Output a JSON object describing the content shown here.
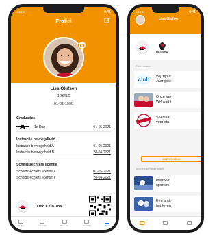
{
  "brand_color": "#f39200",
  "phone1": {
    "status_time": "9:41",
    "title": "Profiel",
    "profile": {
      "name": "Lisa Olufsen",
      "member_number": "123456",
      "birthdate": "01-01-1990"
    },
    "graduaties": {
      "title": "Graduaties",
      "rows": [
        {
          "label": "1e Dan",
          "date": "01-05-2021"
        }
      ]
    },
    "instructie": {
      "title": "Instructie bevoegdheid",
      "rows": [
        {
          "label": "Instructie bevoegdheid A",
          "date": "01-05-2021"
        },
        {
          "label": "Instructie bevoegdheid B",
          "date": "28-04-2021"
        }
      ]
    },
    "scheidsrechters": {
      "title": "Scheidsrechters licentie",
      "rows": [
        {
          "label": "Scheidsrechters licentie X",
          "date": "01-05-2021"
        },
        {
          "label": "Scheidsrechters licentie Y",
          "date": "28-04-2021"
        }
      ]
    },
    "club": {
      "name": "Judo Club JBN"
    },
    "tabs": [
      {
        "label": "Nieuws",
        "icon": "news-icon"
      },
      {
        "label": "Kalender",
        "icon": "calendar-icon"
      },
      {
        "label": "Bijzonder",
        "icon": "grid-icon"
      },
      {
        "label": "Wedstrijd",
        "icon": "trophy-icon"
      },
      {
        "label": "Meer",
        "icon": "more-icon",
        "active": true
      }
    ]
  },
  "phone2": {
    "status_time": "9:41",
    "title": "Lisa Olufsen",
    "strip": [
      {
        "label": "MATSURU"
      }
    ],
    "club_label": "Club nieuws",
    "news_club": [
      {
        "text1": "Wij zijn d",
        "text2": "Jaar gew"
      },
      {
        "text1": "Onze Ver",
        "text2": "WK met t"
      },
      {
        "text1": "Speciaal",
        "text2": "voor stu"
      }
    ],
    "more_button": "MEER CLUB NI",
    "nl_label": "Judo Nederland nieuws",
    "news_nl": [
      {
        "text1": "Instroom",
        "text2": "sporters"
      },
      {
        "text1": "Een amb",
        "text2": "het leven"
      }
    ]
  }
}
